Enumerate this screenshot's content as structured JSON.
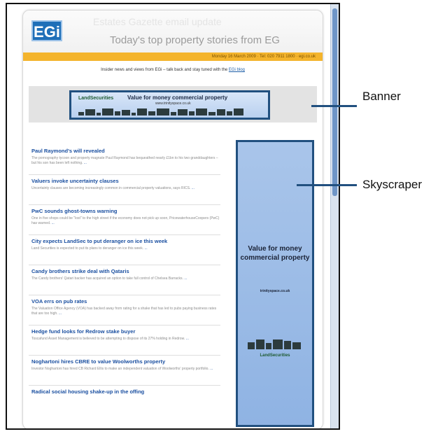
{
  "header": {
    "logo": "EGi",
    "tagline": "Today's top property stories from EG",
    "ghost_heading": "Estates Gazette email update",
    "bar_info": "Monday 16 March 2009 · Tel: 020 7911 1800 · egi.co.uk"
  },
  "intro": {
    "text": "Insider news and views from EGi – talk back and stay tuned with the ",
    "link": "EGi blog"
  },
  "banner": {
    "brand": "LandSecurities",
    "title": "Value for money commercial property",
    "url": "www.trinityspace.co.uk"
  },
  "articles": [
    {
      "title": "Paul Raymond's will revealed",
      "desc": "The pornography tycoon and property magnate Paul Raymond has bequeathed nearly £1bn to his two granddaughters – but his son has been left nothing.",
      "more": "..."
    },
    {
      "title": "Valuers invoke uncertainty clauses",
      "desc": "Uncertainty clauses are becoming increasingly common in commercial property valuations, says RICS.",
      "more": "..."
    },
    {
      "title": "PwC sounds ghost-towns warning",
      "desc": "One in five shops could be \"lost\" to the high street if the economy does not pick up soon, PricewaterhouseCoopers (PwC) has warned.",
      "more": "..."
    },
    {
      "title": "City expects LandSec to put deranger on ice this week",
      "desc": "Land Securities is expected to put its plans to deranger on ice this week.",
      "more": "..."
    },
    {
      "title": "Candy brothers strike deal with Qataris",
      "desc": "The Candy brothers' Qatari backer has acquired an option to take full control of Chelsea Barracks.",
      "more": "..."
    },
    {
      "title": "VOA errs on pub rates",
      "desc": "The Valuation Office Agency (VOA) has backed away from rating for a shake that has led to pubs paying business rates that are too high.",
      "more": "..."
    },
    {
      "title": "Hedge fund looks for Redrow stake buyer",
      "desc": "Toscafund Asset Management is believed to be attempting to dispose of its 27% holding in Redrow.",
      "more": "..."
    },
    {
      "title": "Noghartoni hires CBRE to value Woolworths property",
      "desc": "Investor Noghartoni has hired CB Richard Ellis to make an independent valuation of Woolworths' property portfolio.",
      "more": "..."
    },
    {
      "title": "Radical social housing shake-up in the offing",
      "desc": "",
      "more": ""
    }
  ],
  "skyscraper": {
    "title": "Value for money commercial property",
    "url": "trinityspace.co.uk",
    "brand": "LandSecurities"
  },
  "callouts": {
    "banner": "Banner",
    "skyscraper": "Skyscraper"
  },
  "colors": {
    "accent": "#21507f",
    "link": "#1a4fa0",
    "orange": "#f4b42c",
    "logo": "#1f6fb8"
  }
}
